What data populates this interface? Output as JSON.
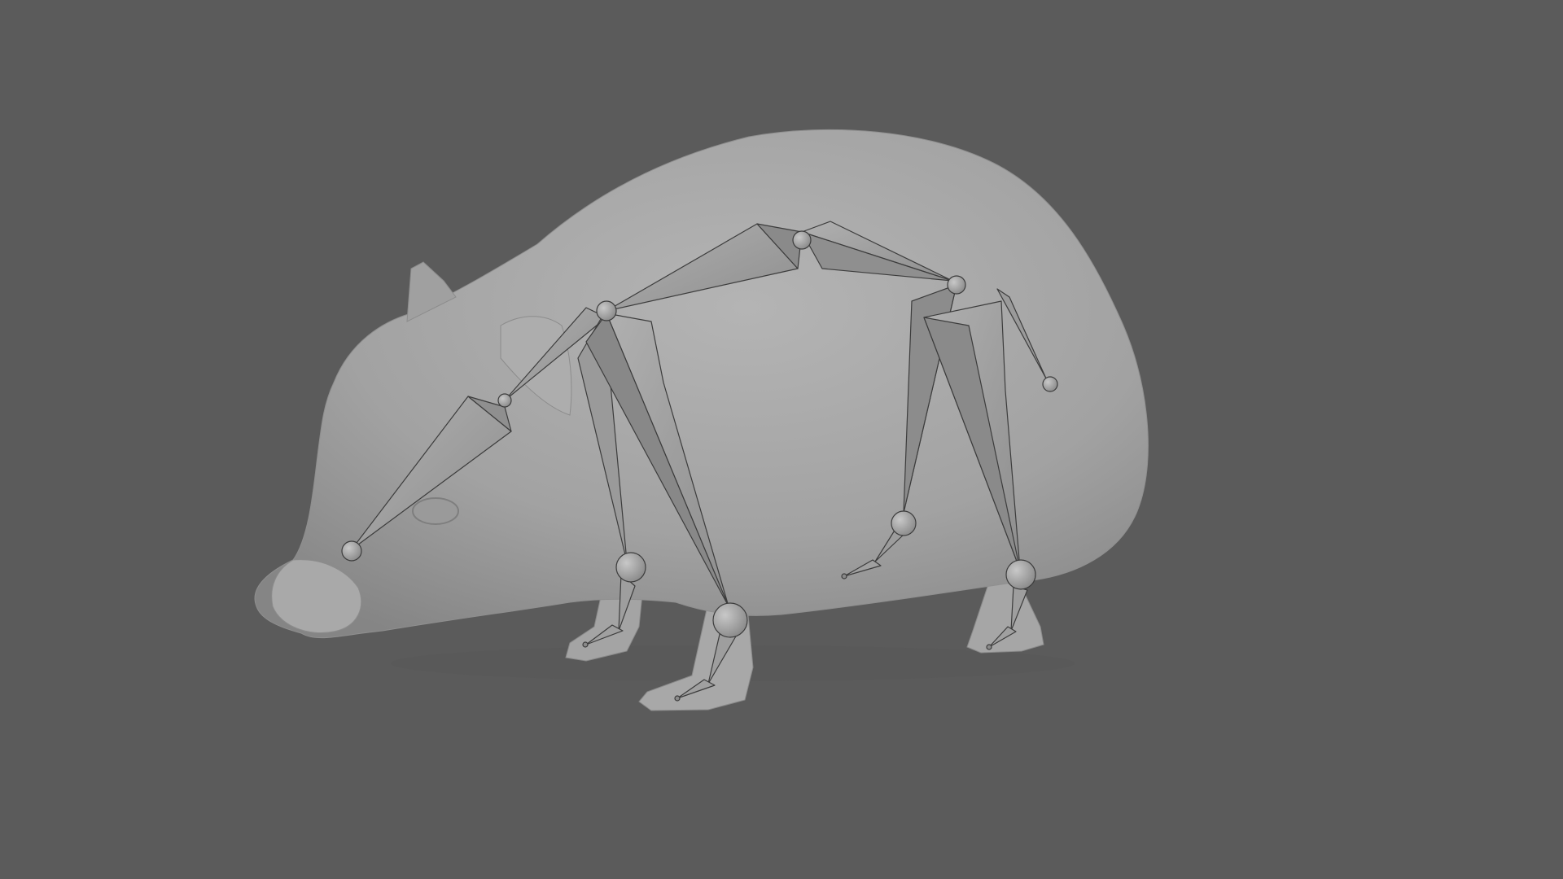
{
  "viewport": {
    "background": "#5b5b5b",
    "mesh_color": "#a3a3a3",
    "bone_color": "#9c9c9c",
    "bone_outline": "#3a3a3a"
  },
  "scene": {
    "mesh": "hamster-model",
    "armature": {
      "bones": [
        "head-bone",
        "neck-bone",
        "spine-front-bone",
        "spine-rear-bone",
        "front-far-upper-leg-bone",
        "front-far-lower-leg-bone",
        "front-far-foot-bone",
        "front-near-upper-leg-bone",
        "front-near-lower-leg-bone",
        "front-near-foot-bone",
        "rear-upper-leg-bone",
        "rear-lower-leg-bone",
        "rear-foot-bone",
        "rear-near-leg-bone",
        "rear-near-foot-bone",
        "tail-bone"
      ]
    }
  }
}
